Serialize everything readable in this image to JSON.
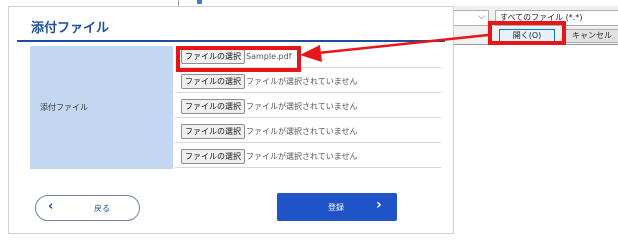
{
  "dialog": {
    "filter_label": "すべてのファイル (*.*)",
    "open_label": "開く(O)",
    "cancel_label": "キャンセル"
  },
  "form": {
    "title": "添付ファイル",
    "attachment_label": "添付ファイル",
    "choose_label": "ファイルの選択",
    "rows": [
      {
        "status": "Sample.pdf"
      },
      {
        "status": "ファイルが選択されていません"
      },
      {
        "status": "ファイルが選択されていません"
      },
      {
        "status": "ファイルが選択されていません"
      },
      {
        "status": "ファイルが選択されていません"
      }
    ],
    "back_label": "戻る",
    "submit_label": "登録"
  },
  "colors": {
    "highlight": "#e8141a",
    "title_blue": "#1d4e9c",
    "submit_blue": "#1f54c9",
    "label_bg": "#c4d7f2"
  },
  "icons": {
    "back": "chevron-left-icon",
    "submit": "chevron-right-icon",
    "dropdown": "chevron-down-icon",
    "callout": "callout-arrow-icon"
  }
}
